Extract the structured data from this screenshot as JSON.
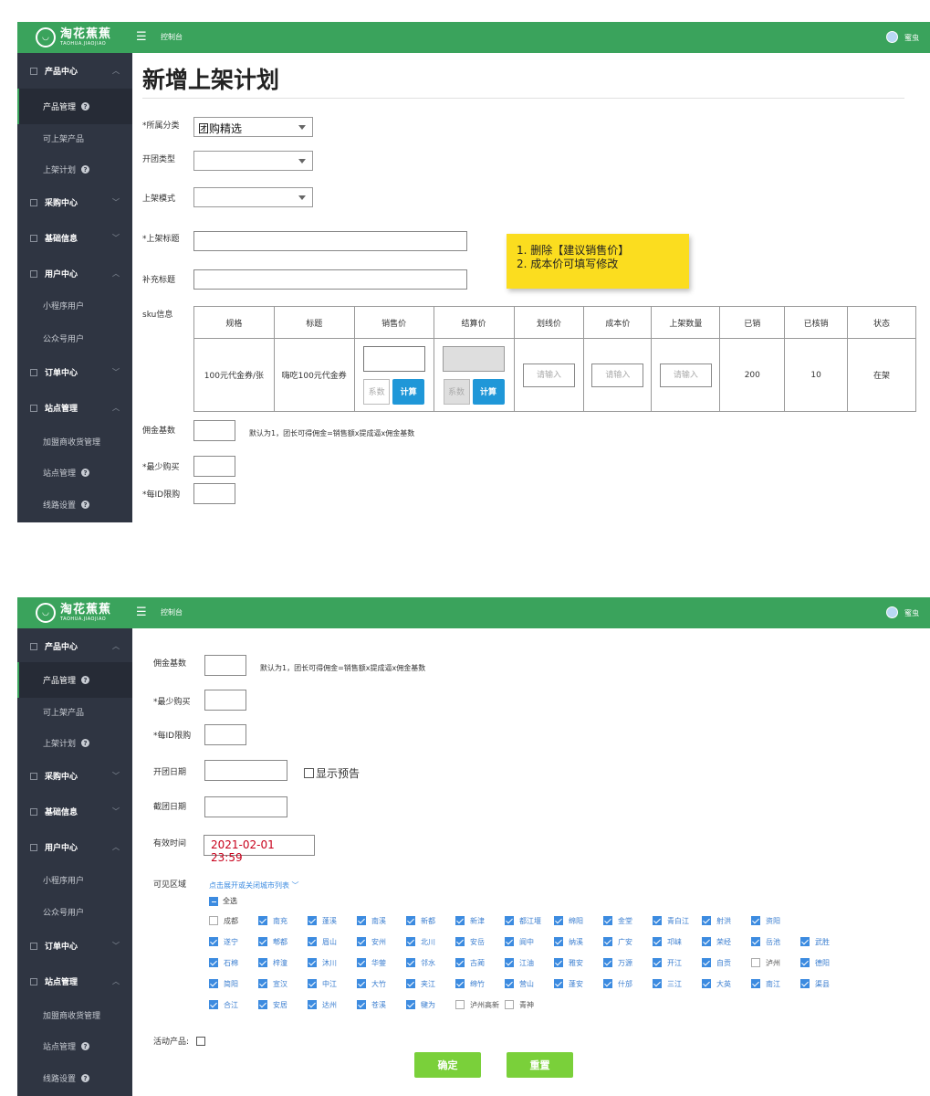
{
  "header": {
    "logo_cn": "淘花蕉蕉",
    "logo_en": "TAOHUA.JIAOJIAO",
    "title": "控制台",
    "user": "蜜虫"
  },
  "sidebar": {
    "product_center": "产品中心",
    "product_manage": "产品管理",
    "listable_products": "可上架产品",
    "listing_plan": "上架计划",
    "purchase_center": "采购中心",
    "basic_info": "基础信息",
    "user_center": "用户中心",
    "miniprogram_users": "小程序用户",
    "official_users": "公众号用户",
    "order_center": "订单中心",
    "site_manage": "站点管理",
    "franchise_receipt": "加盟商收货管理",
    "site_admin": "站点管理",
    "route_settings": "线路设置"
  },
  "form1": {
    "page_title": "新增上架计划",
    "category_label": "*所属分类",
    "category_value": "团购精选",
    "group_type_label": "开团类型",
    "listing_mode_label": "上架模式",
    "listing_title_label": "*上架标题",
    "extra_title_label": "补充标题",
    "sku_label": "sku信息",
    "commission_label": "佣金基数",
    "commission_hint": "默认为1，团长可得佣金=销售额x提成逼x佣金基数",
    "min_buy_label": "*最少购买",
    "per_id_limit_label": "*每ID限购"
  },
  "note": {
    "line1": "1. 删除【建议销售价】",
    "line2": "2. 成本价可填写修改"
  },
  "sku_table": {
    "headers": [
      "规格",
      "标题",
      "销售价",
      "结算价",
      "划线价",
      "成本价",
      "上架数量",
      "已销",
      "已核销",
      "状态"
    ],
    "row": {
      "spec": "100元代金券/张",
      "title": "嗨吃100元代金券",
      "coef_placeholder": "系数",
      "calc_button": "计算",
      "input_placeholder": "请输入",
      "sold": "200",
      "verified": "10",
      "status": "在架"
    }
  },
  "form2": {
    "commission_label": "佣金基数",
    "commission_hint": "默认为1，团长可得佣金=销售额x提成逼x佣金基数",
    "min_buy_label": "*最少购买",
    "per_id_limit_label": "*每ID限购",
    "open_date_label": "开团日期",
    "show_preview_label": "显示预告",
    "close_date_label": "截团日期",
    "valid_time_label": "有效时间",
    "valid_time_value": "2021-02-01 23:59",
    "visible_area_label": "可见区域",
    "toggle_cities_link": "点击展开或关闭城市列表",
    "select_all_label": "全选",
    "activity_product_label": "活动产品:",
    "confirm_button": "确定",
    "reset_button": "重置"
  },
  "cities": [
    [
      {
        "name": "成都",
        "checked": false
      },
      {
        "name": "南充",
        "checked": true
      },
      {
        "name": "蓬溪",
        "checked": true
      },
      {
        "name": "南溪",
        "checked": true
      },
      {
        "name": "新都",
        "checked": true
      },
      {
        "name": "新津",
        "checked": true
      },
      {
        "name": "都江堰",
        "checked": true
      },
      {
        "name": "绵阳",
        "checked": true
      },
      {
        "name": "金堂",
        "checked": true
      },
      {
        "name": "青白江",
        "checked": true
      },
      {
        "name": "射洪",
        "checked": true
      },
      {
        "name": "资阳",
        "checked": true
      }
    ],
    [
      {
        "name": "遂宁",
        "checked": true
      },
      {
        "name": "郫都",
        "checked": true
      },
      {
        "name": "眉山",
        "checked": true
      },
      {
        "name": "安州",
        "checked": true
      },
      {
        "name": "北川",
        "checked": true
      },
      {
        "name": "安岳",
        "checked": true
      },
      {
        "name": "阆中",
        "checked": true
      },
      {
        "name": "纳溪",
        "checked": true
      },
      {
        "name": "广安",
        "checked": true
      },
      {
        "name": "邛崃",
        "checked": true
      },
      {
        "name": "荣经",
        "checked": true
      },
      {
        "name": "岳池",
        "checked": true
      },
      {
        "name": "武胜",
        "checked": true
      }
    ],
    [
      {
        "name": "石棉",
        "checked": true
      },
      {
        "name": "梓潼",
        "checked": true
      },
      {
        "name": "沐川",
        "checked": true
      },
      {
        "name": "华蓥",
        "checked": true
      },
      {
        "name": "邻水",
        "checked": true
      },
      {
        "name": "古蔺",
        "checked": true
      },
      {
        "name": "江油",
        "checked": true
      },
      {
        "name": "雅安",
        "checked": true
      },
      {
        "name": "万源",
        "checked": true
      },
      {
        "name": "开江",
        "checked": true
      },
      {
        "name": "自贡",
        "checked": true
      },
      {
        "name": "泸州",
        "checked": false
      },
      {
        "name": "德阳",
        "checked": true
      }
    ],
    [
      {
        "name": "简阳",
        "checked": true
      },
      {
        "name": "宣汉",
        "checked": true
      },
      {
        "name": "中江",
        "checked": true
      },
      {
        "name": "大竹",
        "checked": true
      },
      {
        "name": "夹江",
        "checked": true
      },
      {
        "name": "绵竹",
        "checked": true
      },
      {
        "name": "营山",
        "checked": true
      },
      {
        "name": "蓬安",
        "checked": true
      },
      {
        "name": "什邡",
        "checked": true
      },
      {
        "name": "三江",
        "checked": true
      },
      {
        "name": "大英",
        "checked": true
      },
      {
        "name": "南江",
        "checked": true
      },
      {
        "name": "渠县",
        "checked": true
      }
    ],
    [
      {
        "name": "合江",
        "checked": true
      },
      {
        "name": "安居",
        "checked": true
      },
      {
        "name": "达州",
        "checked": true
      },
      {
        "name": "苍溪",
        "checked": true
      },
      {
        "name": "犍为",
        "checked": true
      },
      {
        "name": "泸州高新",
        "checked": false
      },
      {
        "name": "青神",
        "checked": false
      }
    ]
  ],
  "colors": {
    "header_green": "#3aa35c",
    "sidebar_bg": "#2f3542",
    "note_yellow": "#fbdd1f",
    "calc_blue": "#1f97d8",
    "checkbox_blue": "#3c8be0",
    "button_green": "#7ad03a",
    "time_red": "#c8001b"
  }
}
